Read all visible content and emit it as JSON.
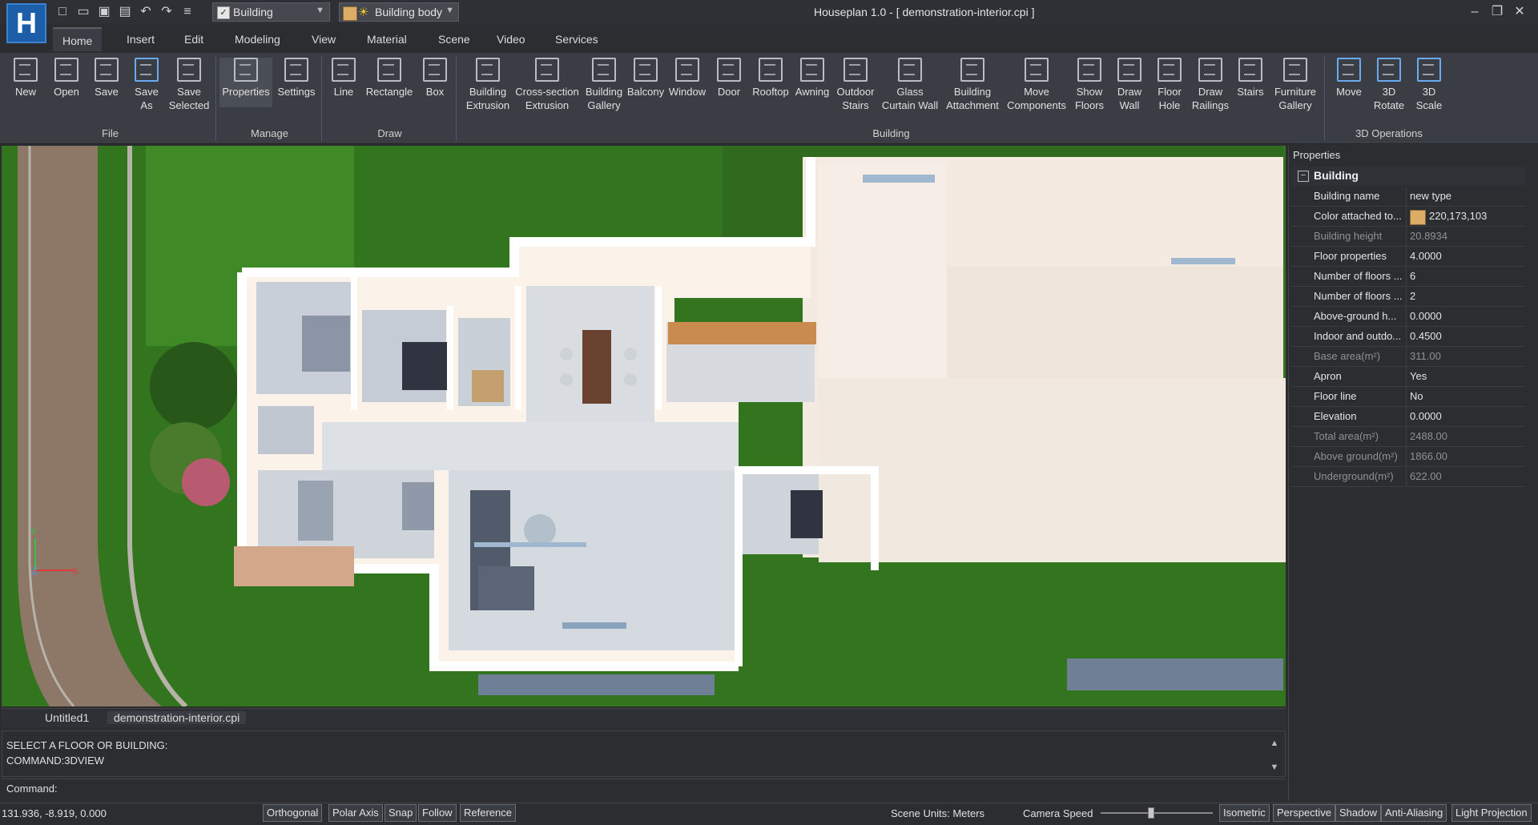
{
  "app": {
    "title": "Houseplan 1.0 -  [ demonstration-interior.cpi ]",
    "logo_letter": "H"
  },
  "quick_access": {
    "icons": [
      "new-file-icon",
      "open-folder-icon",
      "save-icon",
      "save-as-icon",
      "undo-icon",
      "redo-icon",
      "layers-icon"
    ],
    "building_combo": "Building",
    "body_combo": "Building body"
  },
  "menu": [
    "Home",
    "Insert",
    "Edit",
    "Modeling",
    "View",
    "Material",
    "Scene",
    "Video",
    "Services"
  ],
  "ribbon": {
    "groups": {
      "file": "File",
      "manage": "Manage",
      "draw": "Draw",
      "building": "Building",
      "ops3d": "3D Operations"
    },
    "buttons": {
      "new": "New",
      "open": "Open",
      "save": "Save",
      "save_as": "Save\nAs",
      "save_selected": "Save\nSelected",
      "properties": "Properties",
      "settings": "Settings",
      "line": "Line",
      "rectangle": "Rectangle",
      "box": "Box",
      "building_extrusion": "Building\nExtrusion",
      "cross_section_extrusion": "Cross-section\nExtrusion",
      "building_gallery": "Building\nGallery",
      "balcony": "Balcony",
      "window": "Window",
      "door": "Door",
      "rooftop": "Rooftop",
      "awning": "Awning",
      "outdoor_stairs": "Outdoor\nStairs",
      "glass_curtain_wall": "Glass\nCurtain Wall",
      "building_attachment": "Building\nAttachment",
      "move_components": "Move\nComponents",
      "show_floors": "Show\nFloors",
      "draw_wall": "Draw\nWall",
      "floor_hole": "Floor\nHole",
      "draw_railings": "Draw\nRailings",
      "stairs": "Stairs",
      "furniture_gallery": "Furniture\nGallery",
      "move": "Move",
      "rotate_3d": "3D\nRotate",
      "scale_3d": "3D\nScale"
    }
  },
  "viewport": {
    "axis_z": "Z",
    "axis_x": "X",
    "axis_y": "Y"
  },
  "doc_tabs": [
    "Untitled1",
    "demonstration-interior.cpi"
  ],
  "console": {
    "lines": [
      "SELECT A FLOOR OR BUILDING:",
      "COMMAND:3DVIEW"
    ],
    "command_label": "Command:",
    "command_value": ""
  },
  "status": {
    "coords": "131.936, -8.919, 0.000",
    "toggles": [
      "Orthogonal",
      "Polar Axis",
      "Snap",
      "Follow",
      "Reference"
    ],
    "scene_units": "Scene Units: Meters",
    "camera_speed": "Camera Speed",
    "camera_speed_level": 0.45,
    "view_toggles": [
      "Isometric",
      "Perspective",
      "Shadow",
      "Anti-Aliasing",
      "Light Projection"
    ]
  },
  "properties": {
    "title": "Properties",
    "section": "Building",
    "rows": [
      {
        "key": "Building name",
        "value": "new type",
        "dim": false
      },
      {
        "key": "Color attached to...",
        "value": "220,173,103",
        "dim": false,
        "swatch": "#dcad67"
      },
      {
        "key": "Building height",
        "value": "20.8934",
        "dim": true
      },
      {
        "key": "Floor properties",
        "value": "4.0000",
        "dim": false
      },
      {
        "key": "Number of floors ...",
        "value": "6",
        "dim": false
      },
      {
        "key": "Number of floors ...",
        "value": "2",
        "dim": false
      },
      {
        "key": "Above-ground h...",
        "value": "0.0000",
        "dim": false
      },
      {
        "key": "Indoor and outdo...",
        "value": "0.4500",
        "dim": false
      },
      {
        "key": "Base area(m²)",
        "value": "311.00",
        "dim": true
      },
      {
        "key": "Apron",
        "value": "Yes",
        "dim": false
      },
      {
        "key": "Floor line",
        "value": "No",
        "dim": false
      },
      {
        "key": "Elevation",
        "value": "0.0000",
        "dim": false
      },
      {
        "key": "Total area(m²)",
        "value": "2488.00",
        "dim": true
      },
      {
        "key": "Above ground(m²)",
        "value": "1866.00",
        "dim": true
      },
      {
        "key": "Underground(m²)",
        "value": "622.00",
        "dim": true
      }
    ]
  },
  "colors": {
    "accent": "#3d83d1",
    "building_color": "#dcad67",
    "grass": "#2f6a1f",
    "road": "#8d7868"
  }
}
